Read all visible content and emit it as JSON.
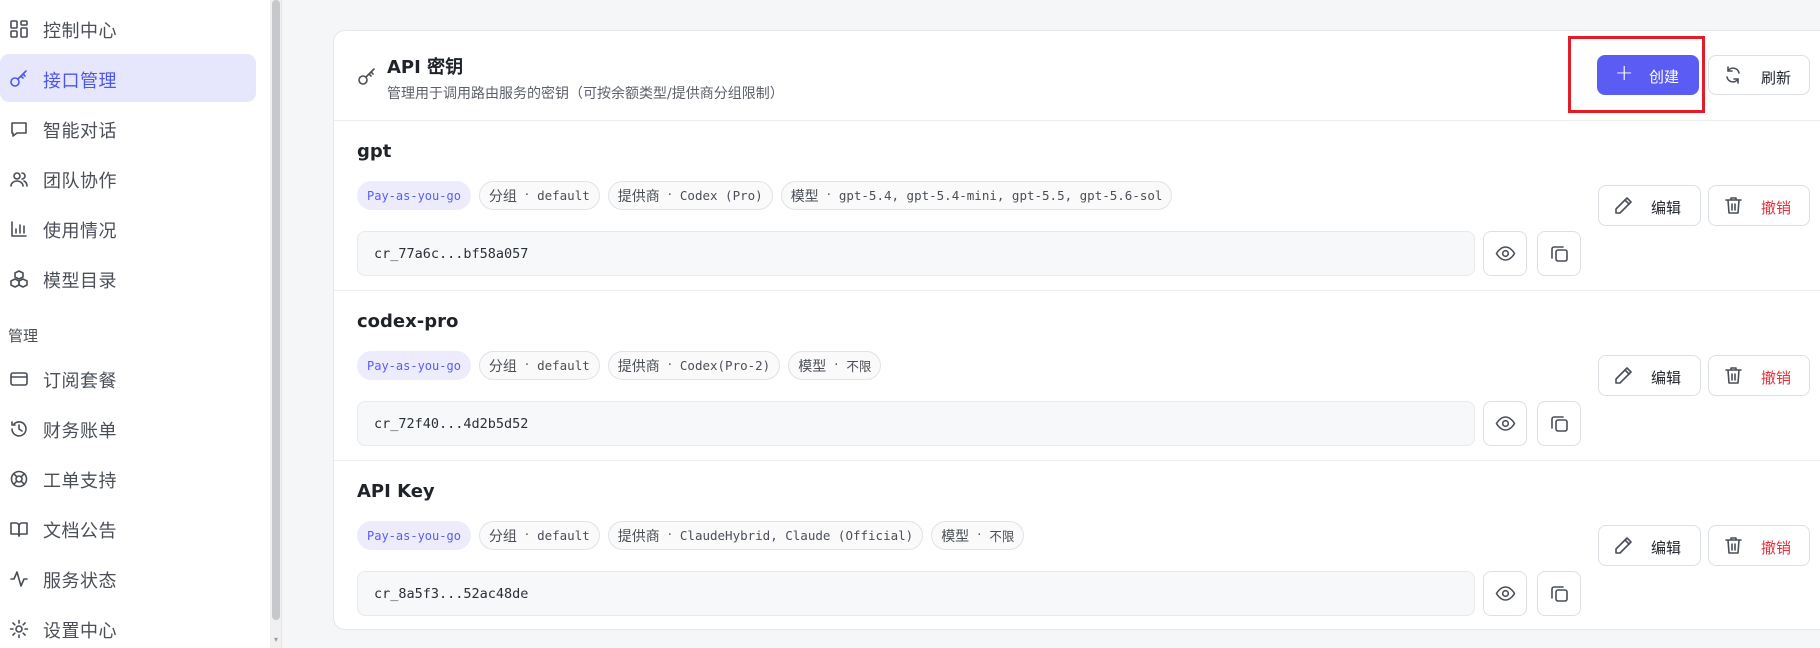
{
  "sidebar": {
    "items": [
      {
        "label": "控制中心",
        "icon": "dashboard-grid-icon"
      },
      {
        "label": "接口管理",
        "icon": "key-icon",
        "active": true
      },
      {
        "label": "智能对话",
        "icon": "chat-bubble-icon"
      },
      {
        "label": "团队协作",
        "icon": "users-icon"
      },
      {
        "label": "使用情况",
        "icon": "bar-chart-icon"
      },
      {
        "label": "模型目录",
        "icon": "boxes-icon"
      }
    ],
    "section_label": "管理",
    "manage_items": [
      {
        "label": "订阅套餐",
        "icon": "credit-card-icon"
      },
      {
        "label": "财务账单",
        "icon": "history-icon"
      },
      {
        "label": "工单支持",
        "icon": "lifebuoy-icon"
      },
      {
        "label": "文档公告",
        "icon": "book-open-icon"
      },
      {
        "label": "服务状态",
        "icon": "activity-icon"
      },
      {
        "label": "设置中心",
        "icon": "gear-icon"
      }
    ]
  },
  "header": {
    "title": "API 密钥",
    "subtitle": "管理用于调用路由服务的密钥（可按余额类型/提供商分组限制）",
    "create_label": "创建",
    "refresh_label": "刷新"
  },
  "keys": [
    {
      "name": "gpt",
      "plan": "Pay-as-you-go",
      "group_key": "分组",
      "group_value": "default",
      "provider_key": "提供商",
      "provider_value": "Codex (Pro)",
      "model_key": "模型",
      "model_value": "gpt-5.4, gpt-5.4-mini, gpt-5.5, gpt-5.6-sol",
      "masked_key": "cr_77a6c...bf58a057",
      "edit_label": "编辑",
      "revoke_label": "撤销"
    },
    {
      "name": "codex-pro",
      "plan": "Pay-as-you-go",
      "group_key": "分组",
      "group_value": "default",
      "provider_key": "提供商",
      "provider_value": "Codex(Pro-2)",
      "model_key": "模型",
      "model_value": "不限",
      "masked_key": "cr_72f40...4d2b5d52",
      "edit_label": "编辑",
      "revoke_label": "撤销"
    },
    {
      "name": "API Key",
      "plan": "Pay-as-you-go",
      "group_key": "分组",
      "group_value": "default",
      "provider_key": "提供商",
      "provider_value": "ClaudeHybrid, Claude (Official)",
      "model_key": "模型",
      "model_value": "不限",
      "masked_key": "cr_8a5f3...52ac48de",
      "edit_label": "编辑",
      "revoke_label": "撤销"
    }
  ],
  "colors": {
    "accent": "#5a5cf4",
    "active_nav_bg": "#e6e7fd",
    "danger": "#e5303c",
    "highlight": "#e11d2a"
  }
}
